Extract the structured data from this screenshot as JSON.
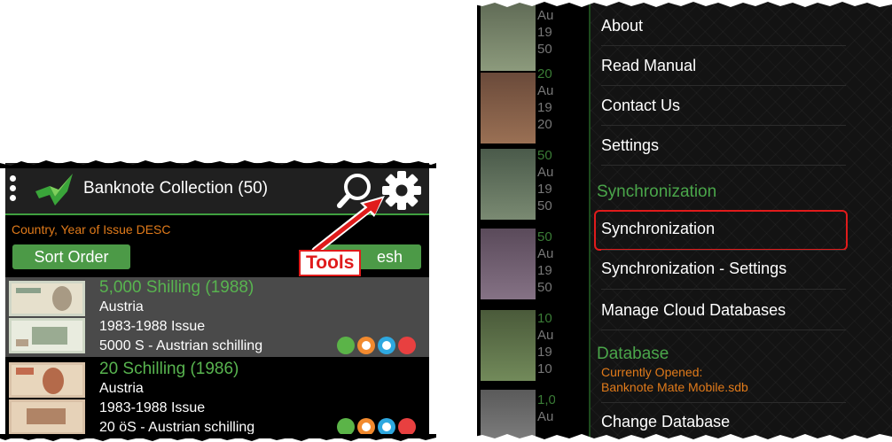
{
  "left_screen": {
    "app_title": "Banknote Collection (50)",
    "sort_description": "Country, Year of Issue DESC",
    "sort_button": "Sort Order",
    "refresh_button": "esh",
    "annotation": "Tools",
    "items": [
      {
        "name": "5,000 Shilling (1988)",
        "country": "Austria",
        "issue": "1983-1988 Issue",
        "detail": "5000 S - Austrian schilling"
      },
      {
        "name": "20 Schilling (1986)",
        "country": "Austria",
        "issue": "1983-1988 Issue",
        "detail": "20 öS - Austrian schilling"
      }
    ],
    "status_dot_colors": [
      "#5bb448",
      "#f28a2e",
      "#2ea8e0",
      "#e84040"
    ]
  },
  "right_screen": {
    "peek_lines": [
      [
        "Au",
        "19",
        "50"
      ],
      [
        "20",
        "Au",
        "19",
        "20"
      ],
      [
        "50",
        "Au",
        "19",
        "50"
      ],
      [
        "50",
        "Au",
        "19",
        "50"
      ],
      [
        "10",
        "Au",
        "19",
        "10"
      ],
      [
        "1,0",
        "Au"
      ]
    ],
    "menu": {
      "about": "About",
      "read_manual": "Read Manual",
      "contact_us": "Contact Us",
      "settings": "Settings",
      "sync_header": "Synchronization",
      "synchronization": "Synchronization",
      "sync_settings": "Synchronization - Settings",
      "manage_cloud": "Manage Cloud Databases",
      "database_header": "Database",
      "currently_opened_label": "Currently Opened:",
      "currently_opened_file": "Banknote Mate Mobile.sdb",
      "change_database": "Change Database"
    }
  }
}
